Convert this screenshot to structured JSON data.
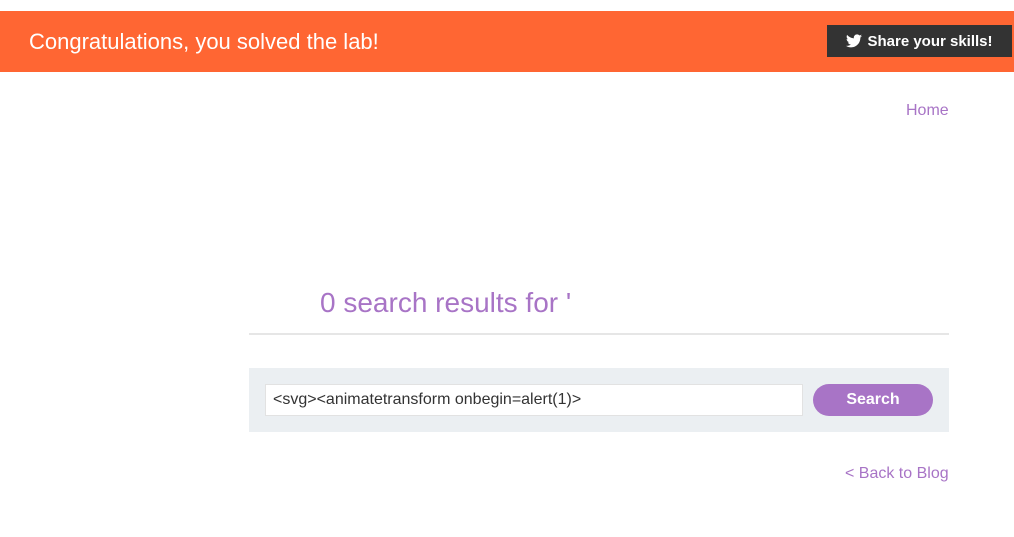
{
  "banner": {
    "message": "Congratulations, you solved the lab!",
    "share_label": "Share your skills!",
    "share_icon": "twitter-icon",
    "background_color": "#ff6633",
    "share_background_color": "#333333"
  },
  "nav": {
    "home_label": "Home"
  },
  "results": {
    "title": "0 search results for '"
  },
  "search": {
    "value": "<svg><animatetransform onbegin=alert(1)>",
    "button_label": "Search"
  },
  "footer": {
    "back_label": "< Back to Blog"
  },
  "colors": {
    "accent": "#a874c6",
    "panel": "#ebeff2"
  }
}
